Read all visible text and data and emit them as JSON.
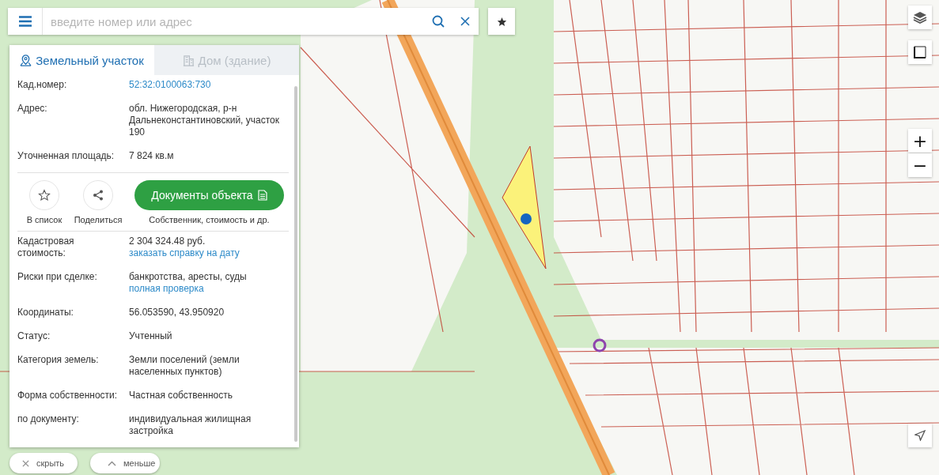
{
  "search": {
    "placeholder": "введите номер или адрес"
  },
  "tabs": [
    {
      "label": "Земельный участок",
      "selected": true,
      "kind": "parcel"
    },
    {
      "label": "Дом (здание)",
      "selected": false,
      "kind": "building"
    }
  ],
  "info_top": [
    {
      "label": "Кад.номер:",
      "value_link": "52:32:0100063:730"
    },
    {
      "label": "Адрес:",
      "value": "обл. Нижегородская, р-н Дальнеконстантиновский, участок 190"
    },
    {
      "label": "Уточненная площадь:",
      "value": "7 824 кв.м"
    }
  ],
  "actions": {
    "favorite": "В список",
    "share": "Поделиться",
    "documents_button": "Документы объекта",
    "documents_caption": "Собственник, стоимость и др."
  },
  "info_bottom": [
    {
      "label": "Кадастровая стоимость:",
      "value": "2 304 324.48 руб.",
      "link": "заказать справку на дату"
    },
    {
      "label": "Риски при сделке:",
      "value": "банкротства, аресты, суды",
      "link": "полная проверка"
    },
    {
      "label": "Координаты:",
      "value": "56.053590, 43.950920"
    },
    {
      "label": "Статус:",
      "value": "Учтенный"
    },
    {
      "label": "Категория земель:",
      "value": "Земли поселений (земли населенных пунктов)"
    },
    {
      "label": "Форма собственности:",
      "value": "Частная собственность"
    },
    {
      "label": "по документу:",
      "value": "индивидуальная жилищная застройка"
    }
  ],
  "bottom_buttons": [
    {
      "label": "скрыть",
      "kind": "close"
    },
    {
      "label": "меньше",
      "kind": "collapse"
    }
  ],
  "zoom": {
    "in": "+",
    "out": "−"
  }
}
